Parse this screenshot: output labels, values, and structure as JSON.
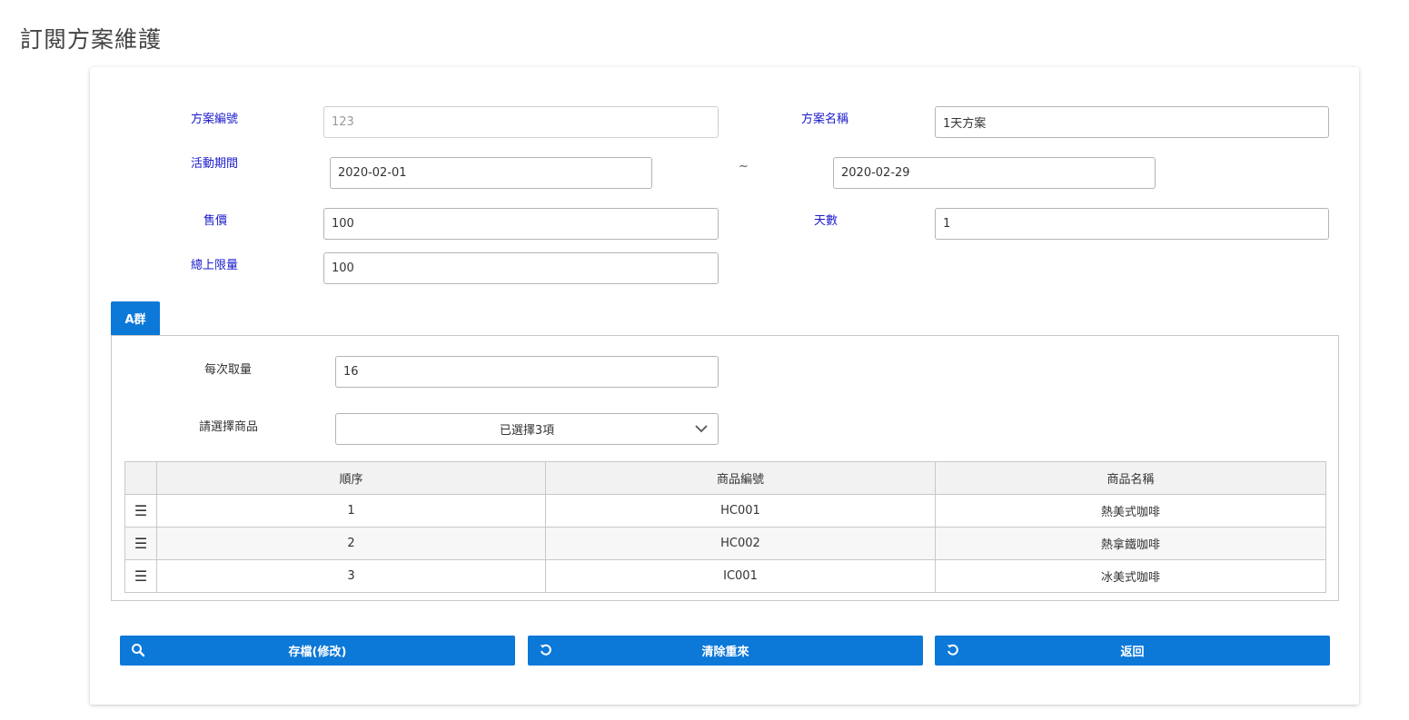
{
  "page": {
    "title": "訂閱方案維護"
  },
  "form": {
    "plan_id": {
      "label": "方案編號",
      "value": "123"
    },
    "plan_name": {
      "label": "方案名稱",
      "value": "1天方案"
    },
    "period": {
      "label": "活動期間",
      "start": "2020-02-01",
      "separator": "~",
      "end": "2020-02-29"
    },
    "price": {
      "label": "售價",
      "value": "100"
    },
    "days": {
      "label": "天數",
      "value": "1"
    },
    "total_limit": {
      "label": "總上限量",
      "value": "100"
    }
  },
  "group": {
    "tab_label": "A群",
    "per_take": {
      "label": "每次取量",
      "value": "16"
    },
    "product_select": {
      "label": "請選擇商品",
      "value": "已選擇3項"
    },
    "table": {
      "columns": [
        "順序",
        "商品編號",
        "商品名稱"
      ],
      "rows": [
        {
          "order": "1",
          "code": "HC001",
          "name": "熱美式咖啡"
        },
        {
          "order": "2",
          "code": "HC002",
          "name": "熱拿鐵咖啡"
        },
        {
          "order": "3",
          "code": "IC001",
          "name": "冰美式咖啡"
        }
      ]
    }
  },
  "buttons": {
    "save": "存檔(修改)",
    "reset": "清除重來",
    "back": "返回"
  },
  "colors": {
    "accent": "#0c78d8",
    "label": "#1a1acc"
  },
  "icons": {
    "save": "search-icon",
    "reset": "undo-icon",
    "back": "undo-icon",
    "row_handle": "drag-handle-icon",
    "select": "chevron-down-icon"
  }
}
